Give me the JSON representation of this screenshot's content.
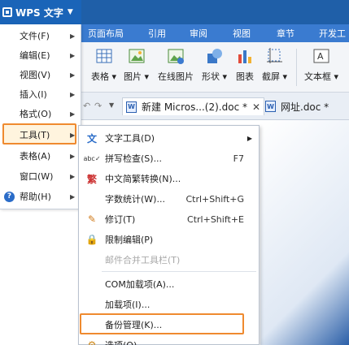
{
  "app": {
    "name": "WPS 文字",
    "brand_color": "#1f5fa8",
    "accent_highlight": "#ef8a2f"
  },
  "ribbon_tabs": [
    "页面布局",
    "引用",
    "审阅",
    "视图",
    "章节",
    "开发工"
  ],
  "ribbon_items": [
    {
      "label": "表格 ▾",
      "icon": "table-icon"
    },
    {
      "label": "图片 ▾",
      "icon": "picture-icon"
    },
    {
      "label": "在线图片",
      "icon": "online-picture-icon"
    },
    {
      "label": "形状 ▾",
      "icon": "shape-icon"
    },
    {
      "label": "图表",
      "icon": "chart-icon"
    },
    {
      "label": "截屏 ▾",
      "icon": "screenshot-icon"
    },
    {
      "label": "文本框 ▾",
      "icon": "textbox-icon"
    }
  ],
  "doc_tabs": [
    {
      "label": "新建 Micros...(2).doc *",
      "close": "✕"
    },
    {
      "label": "网址.doc *"
    }
  ],
  "main_menu": [
    {
      "label": "文件(F)"
    },
    {
      "label": "编辑(E)"
    },
    {
      "label": "视图(V)"
    },
    {
      "label": "插入(I)"
    },
    {
      "label": "格式(O)"
    },
    {
      "label": "工具(T)"
    },
    {
      "label": "表格(A)"
    },
    {
      "label": "窗口(W)"
    },
    {
      "label": "帮助(H)"
    }
  ],
  "tools_submenu": [
    {
      "label": "文字工具(D)",
      "icon": "text-tool-icon",
      "shortcut": ""
    },
    {
      "label": "拼写检查(S)...",
      "icon": "spellcheck-icon",
      "shortcut": "F7"
    },
    {
      "label": "中文简繁转换(N)...",
      "icon": "chinese-convert-icon",
      "shortcut": ""
    },
    {
      "label": "字数统计(W)...",
      "icon": "",
      "shortcut": "Ctrl+Shift+G"
    },
    {
      "label": "修订(T)",
      "icon": "revision-icon",
      "shortcut": "Ctrl+Shift+E"
    },
    {
      "label": "限制编辑(P)",
      "icon": "lock-icon",
      "shortcut": ""
    },
    {
      "label": "邮件合并工具栏(T)",
      "icon": "",
      "shortcut": ""
    },
    {
      "label": "COM加载项(A)...",
      "icon": "",
      "shortcut": ""
    },
    {
      "label": "加载项(I)...",
      "icon": "",
      "shortcut": ""
    },
    {
      "label": "备份管理(K)...",
      "icon": "",
      "shortcut": ""
    },
    {
      "label": "选项(O)...",
      "icon": "gear-icon",
      "shortcut": ""
    }
  ]
}
